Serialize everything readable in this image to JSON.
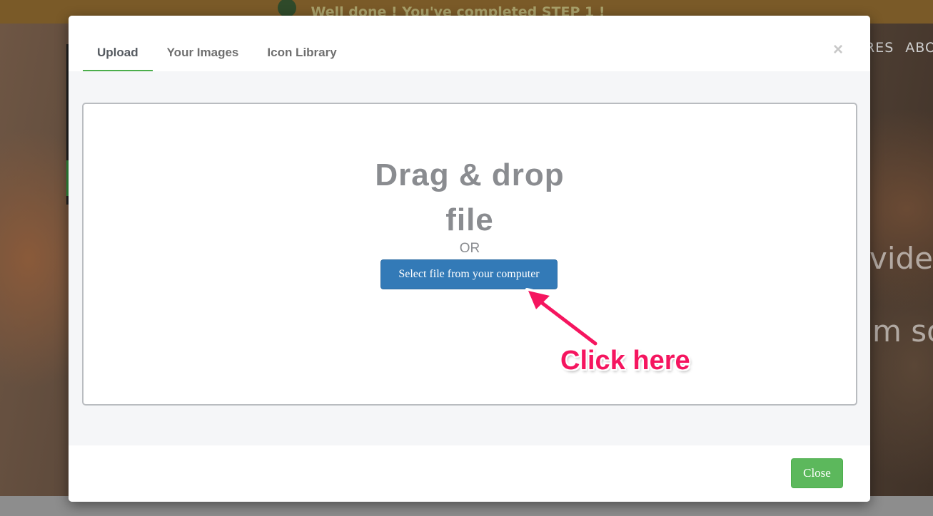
{
  "background": {
    "banner_text": "Well done ! You've completed STEP 1 !",
    "nav_items": [
      "RES",
      "ABO"
    ],
    "hero_fragment_1": "video",
    "hero_fragment_2": "m so"
  },
  "modal": {
    "tabs": [
      {
        "label": "Upload",
        "active": true
      },
      {
        "label": "Your Images",
        "active": false
      },
      {
        "label": "Icon Library",
        "active": false
      }
    ],
    "close_icon": "×",
    "dropzone": {
      "title_line_1": "Drag & drop",
      "title_line_2": "file",
      "or_text": "OR",
      "select_button_label": "Select file from your computer"
    },
    "footer": {
      "close_button_label": "Close"
    }
  },
  "annotation": {
    "text": "Click here",
    "color": "#f5155f"
  },
  "colors": {
    "active_tab_underline": "#4cae4c",
    "primary_button": "#337ab7",
    "success_button": "#5cb85c"
  }
}
